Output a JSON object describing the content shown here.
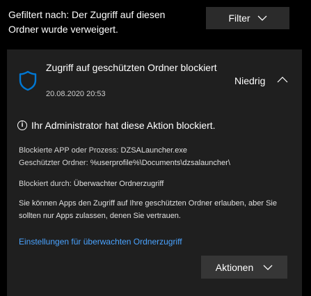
{
  "header": {
    "filter_text": "Gefiltert nach: Der Zugriff auf diesen Ordner wurde verweigert.",
    "filter_button_label": "Filter"
  },
  "alert": {
    "title": "Zugriff auf geschützten Ordner blockiert",
    "date": "20.08.2020 20:53",
    "severity": "Niedrig",
    "blocked_message": "Ihr Administrator hat diese Aktion blockiert.",
    "app_label": "Blockierte APP oder Prozess:",
    "app_value": "DZSALauncher.exe",
    "folder_label": "Geschützter Ordner:",
    "folder_value": "%userprofile%\\Documents\\dzsalauncher\\",
    "blocked_by_label": "Blockiert durch:",
    "blocked_by_value": "Überwachter Ordnerzugriff",
    "description": "Sie können Apps den Zugriff auf Ihre geschützten Ordner erlauben, aber Sie sollten nur Apps zulassen, denen Sie vertrauen.",
    "settings_link": "Einstellungen für überwachten Ordnerzugriff",
    "actions_button_label": "Aktionen"
  },
  "icons": {
    "shield": "shield-icon",
    "info": "info-icon",
    "chevron_down": "chevron-down-icon",
    "chevron_up": "chevron-up-icon"
  },
  "colors": {
    "background": "#000000",
    "card": "#1f1f1f",
    "button": "#2b2b2b",
    "accent": "#0078d4",
    "link": "#4aa3ff"
  }
}
